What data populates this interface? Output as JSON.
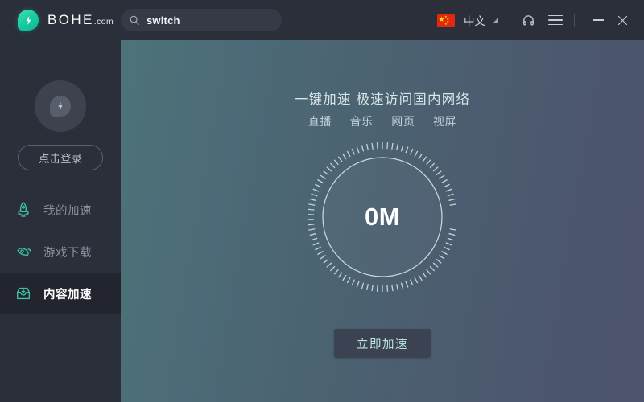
{
  "app": {
    "brand_name": "BOHE",
    "brand_suffix": ".com",
    "logo_icon": "bolt-drop-logo"
  },
  "titlebar": {
    "search": {
      "value": "switch",
      "placeholder": "switch",
      "icon": "search-icon"
    },
    "language": {
      "label": "中文",
      "flag": "china-flag-icon",
      "caret": "chevron-down-icon"
    },
    "support_icon": "headset-icon",
    "menu_icon": "hamburger-menu-icon",
    "minimize_label": "–",
    "close_label": "✕"
  },
  "sidebar": {
    "avatar_icon": "avatar-logo-icon",
    "login_label": "点击登录",
    "items": [
      {
        "label": "我的加速",
        "icon": "rocket-icon",
        "active": false
      },
      {
        "label": "游戏下载",
        "icon": "game-controller-icon",
        "active": false
      },
      {
        "label": "内容加速",
        "icon": "inbox-box-icon",
        "active": true
      }
    ]
  },
  "main": {
    "headline": "一键加速 极速访问国内网络",
    "tags": [
      "直播",
      "音乐",
      "网页",
      "视屏"
    ],
    "dial": {
      "value": "0M",
      "ticks": 90
    },
    "cta_label": "立即加速"
  },
  "colors": {
    "brand_teal": "#18c9a0",
    "sidebar_bg": "#2b2f3a",
    "sidebar_active_bg": "#22252e",
    "main_gradient_start": "#4d7379",
    "main_gradient_end": "#4d556e",
    "cta_bg": "#3b4352",
    "cta_text": "#b8e3e2",
    "flag_red": "#de2910",
    "flag_yellow": "#ffde00"
  }
}
